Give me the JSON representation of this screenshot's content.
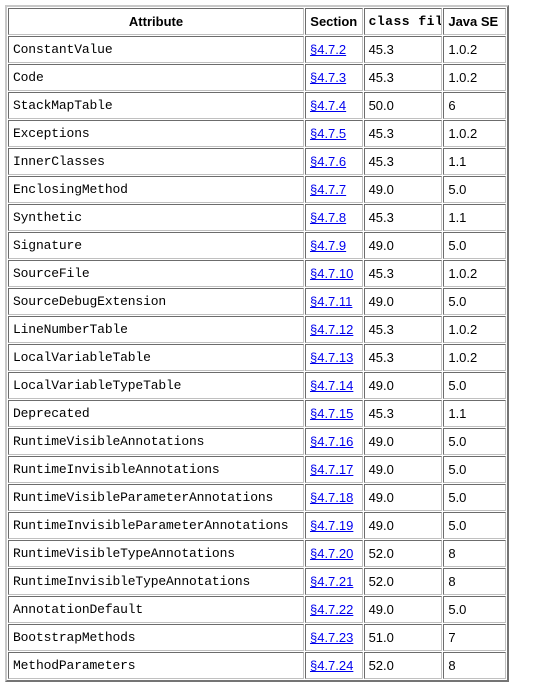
{
  "table": {
    "columns": [
      {
        "key": "attribute",
        "label": "Attribute"
      },
      {
        "key": "section",
        "label": "Section"
      },
      {
        "key": "class_file",
        "label": "class file"
      },
      {
        "key": "java_se",
        "label": "Java SE"
      }
    ],
    "link_prefix": "§",
    "link_color": "#0000ee",
    "rows": [
      {
        "attribute": "ConstantValue",
        "section": "4.7.2",
        "class_file": "45.3",
        "java_se": "1.0.2"
      },
      {
        "attribute": "Code",
        "section": "4.7.3",
        "class_file": "45.3",
        "java_se": "1.0.2"
      },
      {
        "attribute": "StackMapTable",
        "section": "4.7.4",
        "class_file": "50.0",
        "java_se": "6"
      },
      {
        "attribute": "Exceptions",
        "section": "4.7.5",
        "class_file": "45.3",
        "java_se": "1.0.2"
      },
      {
        "attribute": "InnerClasses",
        "section": "4.7.6",
        "class_file": "45.3",
        "java_se": "1.1"
      },
      {
        "attribute": "EnclosingMethod",
        "section": "4.7.7",
        "class_file": "49.0",
        "java_se": "5.0"
      },
      {
        "attribute": "Synthetic",
        "section": "4.7.8",
        "class_file": "45.3",
        "java_se": "1.1"
      },
      {
        "attribute": "Signature",
        "section": "4.7.9",
        "class_file": "49.0",
        "java_se": "5.0"
      },
      {
        "attribute": "SourceFile",
        "section": "4.7.10",
        "class_file": "45.3",
        "java_se": "1.0.2"
      },
      {
        "attribute": "SourceDebugExtension",
        "section": "4.7.11",
        "class_file": "49.0",
        "java_se": "5.0"
      },
      {
        "attribute": "LineNumberTable",
        "section": "4.7.12",
        "class_file": "45.3",
        "java_se": "1.0.2"
      },
      {
        "attribute": "LocalVariableTable",
        "section": "4.7.13",
        "class_file": "45.3",
        "java_se": "1.0.2"
      },
      {
        "attribute": "LocalVariableTypeTable",
        "section": "4.7.14",
        "class_file": "49.0",
        "java_se": "5.0"
      },
      {
        "attribute": "Deprecated",
        "section": "4.7.15",
        "class_file": "45.3",
        "java_se": "1.1"
      },
      {
        "attribute": "RuntimeVisibleAnnotations",
        "section": "4.7.16",
        "class_file": "49.0",
        "java_se": "5.0"
      },
      {
        "attribute": "RuntimeInvisibleAnnotations",
        "section": "4.7.17",
        "class_file": "49.0",
        "java_se": "5.0"
      },
      {
        "attribute": "RuntimeVisibleParameterAnnotations",
        "section": "4.7.18",
        "class_file": "49.0",
        "java_se": "5.0"
      },
      {
        "attribute": "RuntimeInvisibleParameterAnnotations",
        "section": "4.7.19",
        "class_file": "49.0",
        "java_se": "5.0"
      },
      {
        "attribute": "RuntimeVisibleTypeAnnotations",
        "section": "4.7.20",
        "class_file": "52.0",
        "java_se": "8"
      },
      {
        "attribute": "RuntimeInvisibleTypeAnnotations",
        "section": "4.7.21",
        "class_file": "52.0",
        "java_se": "8"
      },
      {
        "attribute": "AnnotationDefault",
        "section": "4.7.22",
        "class_file": "49.0",
        "java_se": "5.0"
      },
      {
        "attribute": "BootstrapMethods",
        "section": "4.7.23",
        "class_file": "51.0",
        "java_se": "7"
      },
      {
        "attribute": "MethodParameters",
        "section": "4.7.24",
        "class_file": "52.0",
        "java_se": "8"
      }
    ]
  }
}
